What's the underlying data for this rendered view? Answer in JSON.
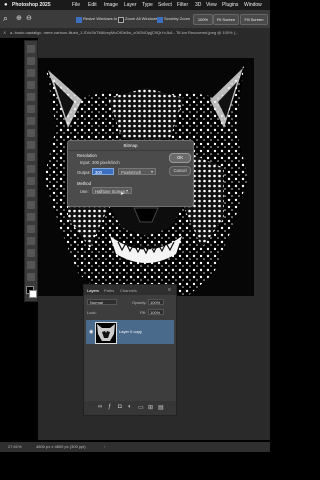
{
  "menubar": {
    "app_name": "Photoshop 2025",
    "items": [
      "File",
      "Edit",
      "Image",
      "Layer",
      "Type",
      "Select",
      "Filter",
      "3D",
      "View",
      "Plugins",
      "Window"
    ]
  },
  "options_bar": {
    "resize_windows": "Resize Windows to Fit",
    "zoom_all": "Zoom All Windows",
    "scrubby_zoom": "Scrubby Zoom",
    "zoom_value": "100%",
    "fit_screen": "Fit Screen",
    "fill_screen": "Fill Screen"
  },
  "tab": {
    "title": "a- bustc-nastaligc. mere-cartoon-illustr_1-SVcSbTMAbnyMoOfOe3w_c0tGNOpjjC9QrYcJkA - Tif-lon Recovered.jpeg @ 100% (..."
  },
  "bitmap_dialog": {
    "title": "Bitmap",
    "resolution_heading": "Resolution",
    "input_label": "Input:",
    "input_value": "300 pixels/inch",
    "output_label": "Output:",
    "output_value": "300",
    "output_unit": "Pixels/Inch",
    "method_heading": "Method",
    "use_label": "Use:",
    "use_value": "Halftone Screen...",
    "ok_label": "OK",
    "cancel_label": "Cancel"
  },
  "layers_panel": {
    "tabs": [
      "Layers",
      "Paths",
      "Channels"
    ],
    "blend_mode": "Normal",
    "opacity_label": "Opacity:",
    "opacity_value": "100%",
    "lock_label": "Lock:",
    "fill_label": "Fill:",
    "fill_value": "100%",
    "layer_name": "Layer 0 copy"
  },
  "status_bar": {
    "zoom": "27.61%",
    "doc_size": "4800 px x 4800 px (300 ppi)"
  },
  "colors": {
    "accent": "#3d6fbf",
    "selected_layer": "#4a6a8c",
    "panel_bg": "#3d3d3d",
    "dialog_bg": "#4b4b4b"
  }
}
